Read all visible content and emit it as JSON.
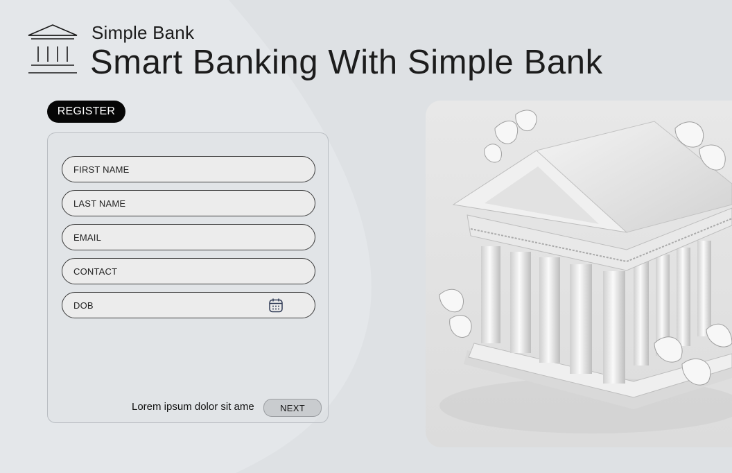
{
  "brand": {
    "name": "Simple Bank",
    "headline": "Smart Banking With Simple Bank",
    "logo_icon": "bank-building-icon"
  },
  "register": {
    "label": "REGISTER"
  },
  "form": {
    "fields": [
      {
        "label": "FIRST NAME"
      },
      {
        "label": "LAST NAME"
      },
      {
        "label": "EMAIL"
      },
      {
        "label": "CONTACT"
      },
      {
        "label": "DOB",
        "icon": "calendar-icon"
      }
    ],
    "footer_text": "Lorem ipsum dolor sit ame",
    "next_label": "NEXT"
  },
  "hero": {
    "image": "white classical bank building with leaves"
  },
  "colors": {
    "background": "#dee1e4",
    "pill": "#060606",
    "field_fill": "#ececec",
    "field_border": "#3a3a3a",
    "next_fill": "#c9cccf"
  }
}
